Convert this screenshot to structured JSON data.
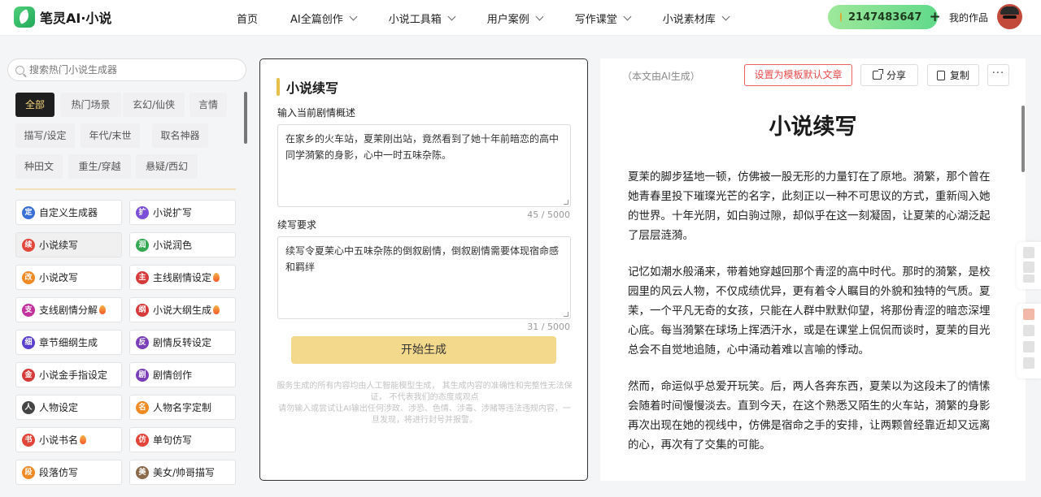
{
  "header": {
    "brand": "笔灵AI·小说",
    "nav": [
      {
        "label": "首页",
        "has_dropdown": false
      },
      {
        "label": "AI全篇创作",
        "has_dropdown": true
      },
      {
        "label": "小说工具箱",
        "has_dropdown": true
      },
      {
        "label": "用户案例",
        "has_dropdown": true
      },
      {
        "label": "写作课堂",
        "has_dropdown": true
      },
      {
        "label": "小说素材库",
        "has_dropdown": true
      }
    ],
    "coins": "2147483647",
    "coin_add": "+",
    "my_works": "我的作品"
  },
  "sidebar": {
    "search_placeholder": "搜索热门小说生成器",
    "categories": [
      "全部",
      "热门场景",
      "玄幻/仙侠",
      "言情",
      "描写/设定",
      "年代/末世",
      "取名神器",
      "种田文",
      "重生/穿越",
      "悬疑/西幻"
    ],
    "tools": [
      {
        "label": "自定义生成器",
        "icon": "定",
        "color": "#3b6fd8",
        "hot": false
      },
      {
        "label": "小说扩写",
        "icon": "扩",
        "color": "#7b4fd8",
        "hot": false
      },
      {
        "label": "小说续写",
        "icon": "续",
        "color": "#e2453a",
        "hot": false
      },
      {
        "label": "小说润色",
        "icon": "润",
        "color": "#34a853",
        "hot": false
      },
      {
        "label": "小说改写",
        "icon": "改",
        "color": "#f08a24",
        "hot": false
      },
      {
        "label": "主线剧情设定",
        "icon": "主",
        "color": "#d63a3a",
        "hot": true
      },
      {
        "label": "支线剧情分解",
        "icon": "支",
        "color": "#c2339e",
        "hot": true
      },
      {
        "label": "小说大纲生成",
        "icon": "纲",
        "color": "#d63a3a",
        "hot": true
      },
      {
        "label": "章节细纲生成",
        "icon": "细",
        "color": "#5b3fd0",
        "hot": false
      },
      {
        "label": "剧情反转设定",
        "icon": "反",
        "color": "#7b3fb8",
        "hot": false
      },
      {
        "label": "小说金手指设定",
        "icon": "金",
        "color": "#d63a3a",
        "hot": false
      },
      {
        "label": "剧情创作",
        "icon": "剧",
        "color": "#7b3fb8",
        "hot": false
      },
      {
        "label": "人物设定",
        "icon": "人",
        "color": "#444444",
        "hot": false
      },
      {
        "label": "人物名字定制",
        "icon": "名",
        "color": "#f08a24",
        "hot": false
      },
      {
        "label": "小说书名",
        "icon": "书",
        "color": "#e2453a",
        "hot": true
      },
      {
        "label": "单句仿写",
        "icon": "仿",
        "color": "#e2453a",
        "hot": false
      },
      {
        "label": "段落仿写",
        "icon": "段",
        "color": "#f08a24",
        "hot": false
      },
      {
        "label": "美女/帅哥描写",
        "icon": "美",
        "color": "#8a6a4a",
        "hot": false
      }
    ]
  },
  "editor": {
    "title": "小说续写",
    "plot_label": "输入当前剧情概述",
    "plot_value": "在家乡的火车站，夏茉刚出站，竟然看到了她十年前暗恋的高中同学漪繁的身影，心中一时五味杂陈。",
    "plot_counter": "45 / 5000",
    "req_label": "续写要求",
    "req_value": "续写令夏茉心中五味杂陈的倒叙剧情，倒叙剧情需要体现宿命感和羁绊",
    "req_counter": "31 / 5000",
    "generate_label": "开始生成",
    "disclaimer_1": "服务生成的所有内容均由人工智能模型生成， 其生成内容的准确性和完整性无法保证， 不代表我们的态度或观点",
    "disclaimer_2": "请勿输入或尝试让AI输出任何涉政、涉恐、色情、涉毒、涉赌等违法违规内容，一旦发现，将进行封号并报警。"
  },
  "output": {
    "ai_note": "（本文由AI生成）",
    "set_default": "设置为模板默认文章",
    "share": "分享",
    "copy": "复制",
    "more": "···",
    "title": "小说续写",
    "paragraphs": [
      "夏茉的脚步猛地一顿，仿佛被一股无形的力量钉在了原地。漪繁，那个曾在她青春里投下璀璨光芒的名字，此刻正以一种不可思议的方式，重新闯入她的世界。十年光阴，如白驹过隙，却似乎在这一刻凝固，让夏茉的心湖泛起了层层涟漪。",
      "记忆如潮水般涌来，带着她穿越回那个青涩的高中时代。那时的漪繁，是校园里的风云人物，不仅成绩优异，更有着令人瞩目的外貌和独特的气质。夏茉，一个平凡无奇的女孩，只能在人群中默默仰望，将那份青涩的暗恋深埋心底。每当漪繁在球场上挥洒汗水，或是在课堂上侃侃而谈时，夏茉的目光总会不自觉地追随，心中涌动着难以言喻的悸动。",
      "然而，命运似乎总爱开玩笑。后，两人各奔东西，夏茉以为这段未了的情愫会随着时间慢慢淡去。直到今天，在这个熟悉又陌生的火车站，漪繁的身影再次出现在她的视线中，仿佛是宿命之手的安排，让两颗曾经靠近却又远离的心，再次有了交集的可能。"
    ]
  }
}
